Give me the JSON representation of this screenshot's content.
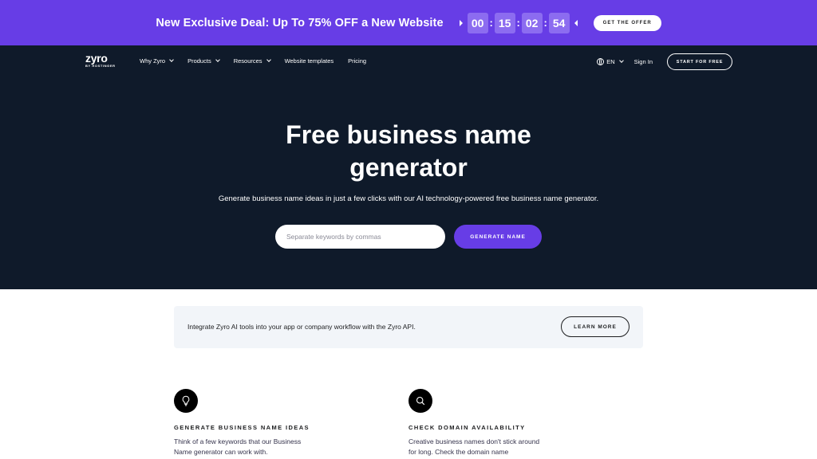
{
  "promo": {
    "text": "New Exclusive Deal: Up To 75% OFF a New Website",
    "timer": [
      "00",
      "15",
      "02",
      "54"
    ],
    "button": "GET THE OFFER"
  },
  "nav": {
    "logo": "zyro",
    "logo_sub": "BY HOSTINGER",
    "items": [
      "Why Zyro",
      "Products",
      "Resources",
      "Website templates",
      "Pricing"
    ],
    "language": "EN",
    "signin": "Sign In",
    "start": "START FOR FREE"
  },
  "hero": {
    "title": "Free business name generator",
    "description": "Generate business name ideas in just a few clicks with our AI technology-powered free business name generator.",
    "input_placeholder": "Separate keywords by commas",
    "button": "GENERATE NAME"
  },
  "api": {
    "text": "Integrate Zyro AI tools into your app or company workflow with the Zyro API.",
    "button": "LEARN MORE"
  },
  "features": [
    {
      "icon": "lightbulb-icon",
      "title": "GENERATE BUSINESS NAME IDEAS",
      "description": "Think of a few keywords that our Business Name generator can work with."
    },
    {
      "icon": "search-icon",
      "title": "CHECK DOMAIN AVAILABILITY",
      "description": "Creative business names don't stick around for long. Check the domain name"
    }
  ],
  "colors": {
    "promo_bg": "#673de6",
    "hero_bg": "#0f1a2a",
    "accent": "#673de6",
    "card_bg": "#f2f5f9"
  }
}
